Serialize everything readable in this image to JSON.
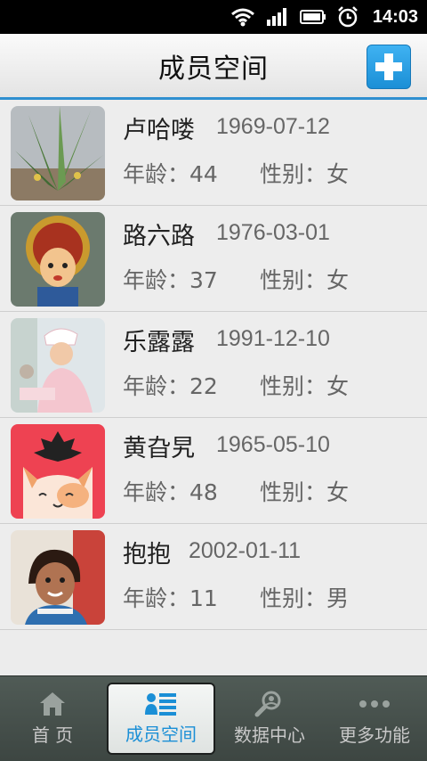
{
  "status_bar": {
    "time": "14:03"
  },
  "header": {
    "title": "成员空间",
    "add_icon": "plus-icon"
  },
  "members": [
    {
      "name": "卢哈喽",
      "dob": "1969-07-12",
      "age": "年龄：44",
      "sex": "性别：女",
      "avatar": "aloe-plant-photo"
    },
    {
      "name": "路六路",
      "dob": "1976-03-01",
      "age": "年龄：37",
      "sex": "性别：女",
      "avatar": "opera-doll-photo"
    },
    {
      "name": "乐露露",
      "dob": "1991-12-10",
      "age": "年龄：22",
      "sex": "性别：女",
      "avatar": "nurse-photo"
    },
    {
      "name": "黄旮旯",
      "dob": "1965-05-10",
      "age": "年龄：48",
      "sex": "性别：女",
      "avatar": "cat-cartoon"
    },
    {
      "name": "抱抱",
      "dob": "2002-01-11",
      "age": "年龄：11",
      "sex": "性别：男",
      "avatar": "child-photo"
    }
  ],
  "tabs": [
    {
      "label": "首 页",
      "icon": "home-icon"
    },
    {
      "label": "成员空间",
      "icon": "members-list-icon",
      "active": true
    },
    {
      "label": "数据中心",
      "icon": "data-search-icon"
    },
    {
      "label": "更多功能",
      "icon": "more-dots-icon"
    }
  ],
  "colors": {
    "accent": "#2e8fd0",
    "tab_bar": "#464f4b",
    "active_tab_text": "#1b8fd6"
  }
}
